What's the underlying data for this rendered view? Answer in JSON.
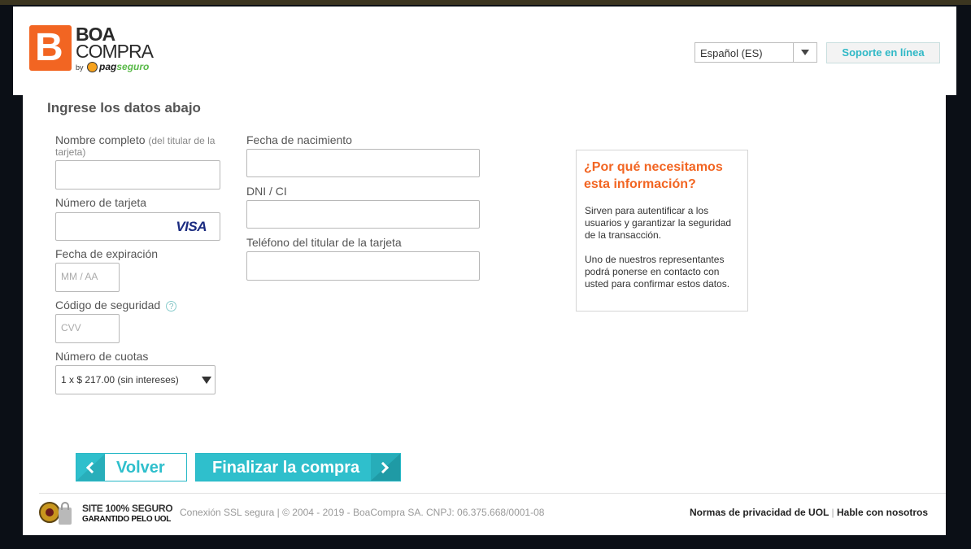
{
  "header": {
    "logo": {
      "line1": "BOA",
      "line2": "COMPRA",
      "by": "by",
      "pag": "pag",
      "seguro": "seguro",
      "icon_letter": "B"
    },
    "language": "Español (ES)",
    "support_label": "Soporte en línea"
  },
  "form": {
    "title": "Ingrese los datos abajo",
    "name_label": "Nombre completo",
    "name_hint_part1": "(del titular de la",
    "name_hint_part2": "tarjeta)",
    "name_value": "",
    "card_label": "Número de tarjeta",
    "card_brand": "VISA",
    "expiry_label": "Fecha de expiración",
    "expiry_placeholder": "MM / AA",
    "cvv_label": "Código de seguridad",
    "cvv_placeholder": "CVV",
    "help_glyph": "?",
    "installments_label": "Número de cuotas",
    "installments_value": "1 x $ 217.00 (sin intereses)",
    "birth_label": "Fecha de nacimiento",
    "dni_label": "DNI / CI",
    "phone_label": "Teléfono del titular de la tarjeta"
  },
  "info": {
    "title": "¿Por qué necesitamos esta información?",
    "p1": "Sirven para autentificar a los usuarios y garantizar la seguridad de la transacción.",
    "p2": "Uno de nuestros representantes podrá ponerse en contacto con usted para confirmar estos datos."
  },
  "actions": {
    "back_label": "Volver",
    "finish_label": "Finalizar la compra"
  },
  "footer": {
    "seal_line1": "SITE 100% SEGURO",
    "seal_line2": "GARANTIDO PELO UOL",
    "copyright": "Conexión SSL segura | © 2004 - 2019 - BoaCompra SA. CNPJ: 06.375.668/0001-08",
    "privacy_link": "Normas de privacidad de UOL",
    "separator": "|",
    "contact_link": "Hable con nosotros"
  },
  "colors": {
    "brand_orange": "#f26522",
    "accent_teal": "#2fbfcc",
    "pagseguro_green": "#58b947"
  }
}
